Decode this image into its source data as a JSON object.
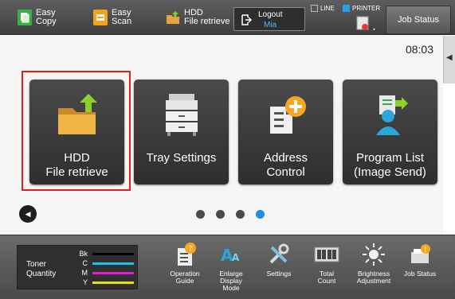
{
  "topbar": {
    "easy_copy": "Easy\nCopy",
    "easy_scan": "Easy\nScan",
    "hdd_file_retrieve": "HDD\nFile retrieve",
    "logout_label": "Logout",
    "logout_user": "Mia",
    "line_label": "LINE",
    "printer_label": "PRINTER",
    "job_status": "Job Status"
  },
  "clock": {
    "time": "08:03"
  },
  "tiles": [
    {
      "label": "HDD\nFile retrieve",
      "icon": "folder-upload-icon",
      "highlighted": true
    },
    {
      "label": "Tray Settings",
      "icon": "printer-tray-icon"
    },
    {
      "label": "Address\nControl",
      "icon": "address-book-add-icon"
    },
    {
      "label": "Program List\n(Image Send)",
      "icon": "program-send-icon"
    }
  ],
  "pager": {
    "page_count": 4,
    "active_index": 3
  },
  "bottombar": {
    "toner": {
      "label": "Toner\nQuantity",
      "channels": [
        {
          "name": "Bk",
          "color": "#000000"
        },
        {
          "name": "C",
          "color": "#19c3ee"
        },
        {
          "name": "M",
          "color": "#e11bd9"
        },
        {
          "name": "Y",
          "color": "#e8e010"
        }
      ]
    },
    "items": [
      {
        "label": "Operation\nGuide",
        "icon": "operation-guide-icon"
      },
      {
        "label": "Enlarge\nDisplay\nMode",
        "icon": "enlarge-display-icon"
      },
      {
        "label": "Settings",
        "icon": "settings-tools-icon"
      },
      {
        "label": "Total\nCount",
        "icon": "total-count-icon"
      },
      {
        "label": "Brightness\nAdjustment",
        "icon": "brightness-icon"
      },
      {
        "label": "Job Status",
        "icon": "job-status-icon"
      }
    ]
  },
  "colors": {
    "accent_blue": "#1e8fe0",
    "highlight_red": "#e02020",
    "tile_dark": "#3a3a3a"
  }
}
